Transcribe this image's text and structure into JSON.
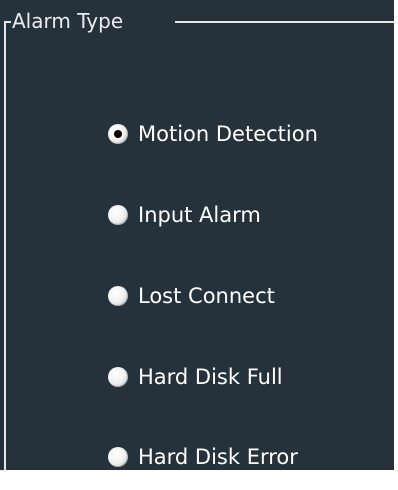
{
  "group": {
    "title": "Alarm Type"
  },
  "options": [
    {
      "label": "Motion Detection",
      "selected": true
    },
    {
      "label": "Input Alarm",
      "selected": false
    },
    {
      "label": "Lost Connect",
      "selected": false
    },
    {
      "label": "Hard Disk Full",
      "selected": false
    },
    {
      "label": "Hard Disk Error",
      "selected": false
    }
  ],
  "colors": {
    "panel_bg": "#25323b",
    "frame": "#e8e8e8",
    "text": "#ffffff"
  }
}
